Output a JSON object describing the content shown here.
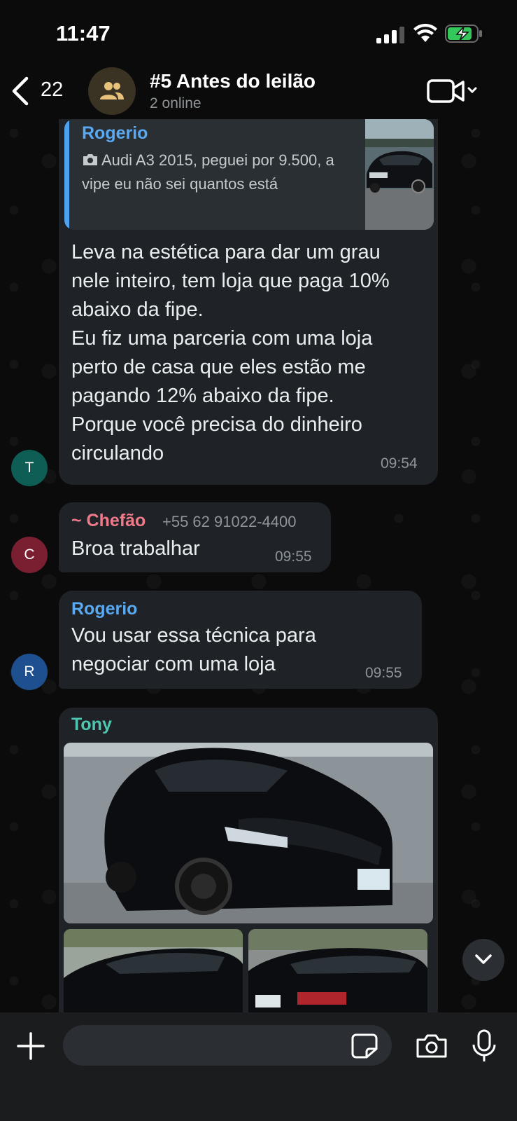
{
  "status_bar": {
    "time": "11:47"
  },
  "header": {
    "back_count": "22",
    "title": "#5 Antes do leilão",
    "subtitle": "2 online"
  },
  "messages": [
    {
      "avatar_letter": "T",
      "avatar_color": "#0f5e55",
      "quote": {
        "sender": "Rogerio",
        "text": "Audi A3 2015, peguei por 9.500, a vipe eu não sei quantos está",
        "media_icon": "camera-icon"
      },
      "text": "Leva na estética para dar um grau\nnele inteiro, tem loja que paga 10%\nabaixo da fipe.\nEu fiz uma parceria com uma loja\nperto de casa que eles estão me\npagando 12% abaixo da fipe.\nPorque você precisa do dinheiro\ncirculando",
      "time": "09:54"
    },
    {
      "avatar_letter": "C",
      "avatar_color": "#7a1e32",
      "sender": "~ Chefão",
      "sender_color": "#f07a8a",
      "phone": "+55 62 91022-4400",
      "text": "Broa trabalhar",
      "time": "09:55"
    },
    {
      "avatar_letter": "R",
      "avatar_color": "#1e4f8e",
      "sender": "Rogerio",
      "sender_color": "#5aa9f3",
      "text": "Vou usar essa técnica para\nnegociar com uma loja",
      "time": "09:55"
    },
    {
      "sender": "Tony",
      "sender_color": "#4fc7b0",
      "photos": [
        "black-sedan-front-photo",
        "black-sedan-side-photo",
        "black-sedan-rear-photo"
      ]
    }
  ],
  "input": {
    "placeholder": ""
  },
  "colors": {
    "bubble": "#1f2327",
    "background": "#0b0b0b",
    "accent_blue": "#4ea3f1"
  }
}
